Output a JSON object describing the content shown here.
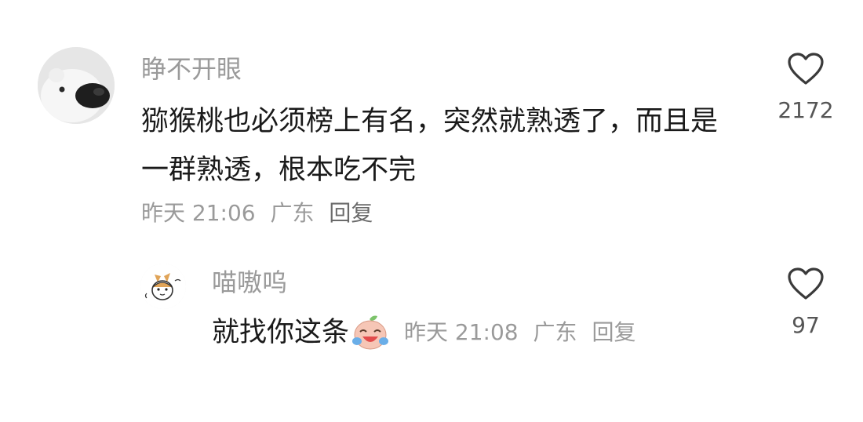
{
  "comment": {
    "username": "睁不开眼",
    "text": "猕猴桃也必须榜上有名，突然就熟透了，而且是一群熟透，根本吃不完",
    "time": "昨天 21:06",
    "location": "广东",
    "reply_label": "回复",
    "likes": "2172",
    "avatar_icon": "polar-bear-avatar-icon",
    "like_icon": "heart-outline-icon"
  },
  "reply": {
    "username": "喵嗷呜",
    "text": "就找你这条",
    "emoji_icon": "crying-laughing-emoji-icon",
    "time": "昨天 21:08",
    "location": "广东",
    "reply_label": "回复",
    "likes": "97",
    "avatar_icon": "cartoon-cat-avatar-icon",
    "like_icon": "heart-outline-icon"
  },
  "colors": {
    "text_primary": "#1a1a1a",
    "text_secondary": "#9a9a9a",
    "background": "#ffffff"
  }
}
